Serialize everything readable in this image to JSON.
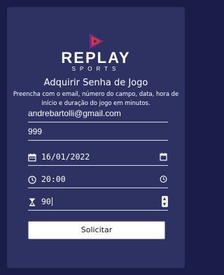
{
  "brand": {
    "name": "REPLAY",
    "sub": "SPORTS",
    "icon": "play-triangle-logo-icon",
    "colors": {
      "primary": "#e8362f",
      "secondary": "#7a2b8a"
    }
  },
  "heading": "Adquirir Senha de Jogo",
  "description": "Preencha com o email, número do campo, data, hora de início e duração do jogo em minutos.",
  "form": {
    "email": {
      "value": "andrebartolli@gmail.com"
    },
    "field_number": {
      "value": "999"
    },
    "date": {
      "value": "16/01/2022",
      "icon": "calendar-icon",
      "picker_icon": "calendar-picker-icon"
    },
    "time": {
      "value": "20:00",
      "icon": "clock-icon",
      "picker_icon": "clock-picker-icon"
    },
    "duration": {
      "value": "90",
      "icon": "hourglass-icon"
    },
    "submit_label": "Solicitar"
  },
  "colors": {
    "page_background": "#1a1d48",
    "card_background": "#2d3262",
    "text": "#ffffff",
    "button_background": "#ffffff"
  }
}
